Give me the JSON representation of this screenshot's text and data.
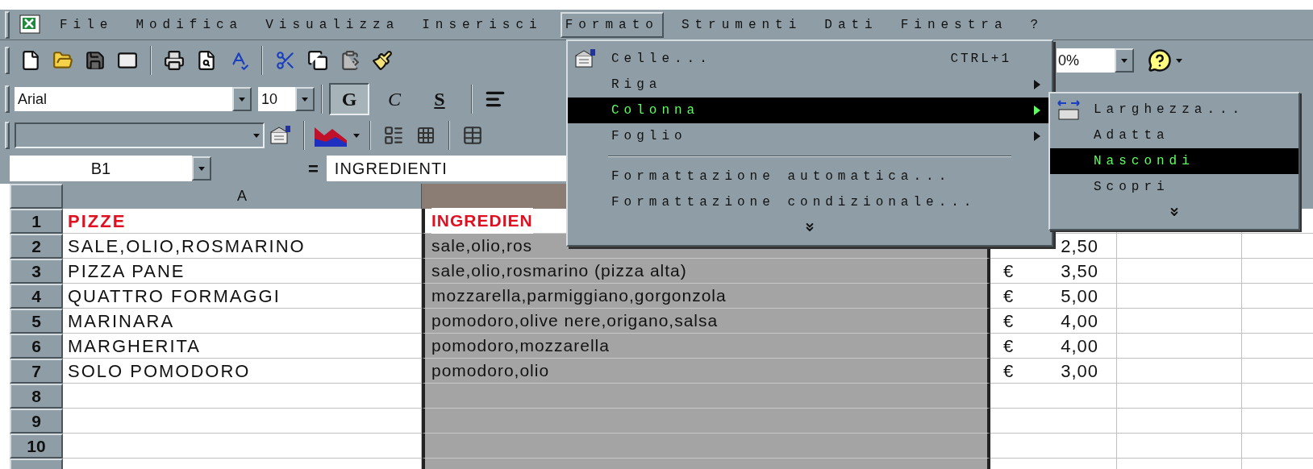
{
  "menu_bar": {
    "items": [
      {
        "label": "File",
        "selected": false
      },
      {
        "label": "Modifica",
        "selected": false
      },
      {
        "label": "Visualizza",
        "selected": false
      },
      {
        "label": "Inserisci",
        "selected": false
      },
      {
        "label": "Formato",
        "selected": true
      },
      {
        "label": "Strumenti",
        "selected": false
      },
      {
        "label": "Dati",
        "selected": false
      },
      {
        "label": "Finestra",
        "selected": false
      },
      {
        "label": "?",
        "selected": false
      }
    ]
  },
  "zoom_field": {
    "value": "0%"
  },
  "formatting": {
    "font": "Arial",
    "size": "10",
    "styles": [
      {
        "label": "G",
        "pressed": true
      },
      {
        "label": "C",
        "pressed": false
      },
      {
        "label": "S",
        "pressed": false
      }
    ]
  },
  "formula_bar": {
    "cell": "B1",
    "equals": "=",
    "value": "INGREDIENTI"
  },
  "format_menu": {
    "items": [
      {
        "kind": "command",
        "label": "Celle...",
        "shortcut": "CTRL+1",
        "selected": false
      },
      {
        "kind": "submenu",
        "label": "Riga",
        "selected": false
      },
      {
        "kind": "submenu",
        "label": "Colonna",
        "selected": true
      },
      {
        "kind": "submenu",
        "label": "Foglio",
        "selected": false
      },
      {
        "kind": "separator"
      },
      {
        "kind": "command",
        "label": "Formattazione automatica...",
        "selected": false
      },
      {
        "kind": "command",
        "label": "Formattazione condizionale...",
        "selected": false
      },
      {
        "kind": "more"
      }
    ]
  },
  "column_submenu": {
    "items": [
      {
        "kind": "command",
        "label": "Larghezza...",
        "selected": false
      },
      {
        "kind": "command",
        "label": "Adatta",
        "selected": false
      },
      {
        "kind": "command",
        "label": "Nascondi",
        "selected": true
      },
      {
        "kind": "command",
        "label": "Scopri",
        "selected": false
      },
      {
        "kind": "more"
      }
    ]
  },
  "sheet": {
    "columns": [
      {
        "label": "A",
        "selected": false
      },
      {
        "selected": true
      }
    ],
    "rows": [
      {
        "number": "1",
        "heading": true,
        "name": "PIZZE",
        "ingredients": "INGREDIEN"
      },
      {
        "number": "2",
        "heading": false,
        "name": "SALE,OLIO,ROSMARINO",
        "ingredients": "sale,olio,ros",
        "price": "2,50"
      },
      {
        "number": "3",
        "heading": false,
        "name": "PIZZA PANE",
        "ingredients": "sale,olio,rosmarino (pizza alta)",
        "currency": "€",
        "price": "3,50"
      },
      {
        "number": "4",
        "heading": false,
        "name": "QUATTRO FORMAGGI",
        "ingredients": "mozzarella,parmiggiano,gorgonzola",
        "currency": "€",
        "price": "5,00"
      },
      {
        "number": "5",
        "heading": false,
        "name": "MARINARA",
        "ingredients": "pomodoro,olive nere,origano,salsa",
        "currency": "€",
        "price": "4,00"
      },
      {
        "number": "6",
        "heading": false,
        "name": "MARGHERITA",
        "ingredients": "pomodoro,mozzarella",
        "currency": "€",
        "price": "4,00"
      },
      {
        "number": "7",
        "heading": false,
        "name": "SOLO POMODORO",
        "ingredients": "pomodoro,olio",
        "currency": "€",
        "price": "3,00"
      },
      {
        "number": "8"
      },
      {
        "number": "9"
      },
      {
        "number": "10"
      },
      {}
    ]
  }
}
